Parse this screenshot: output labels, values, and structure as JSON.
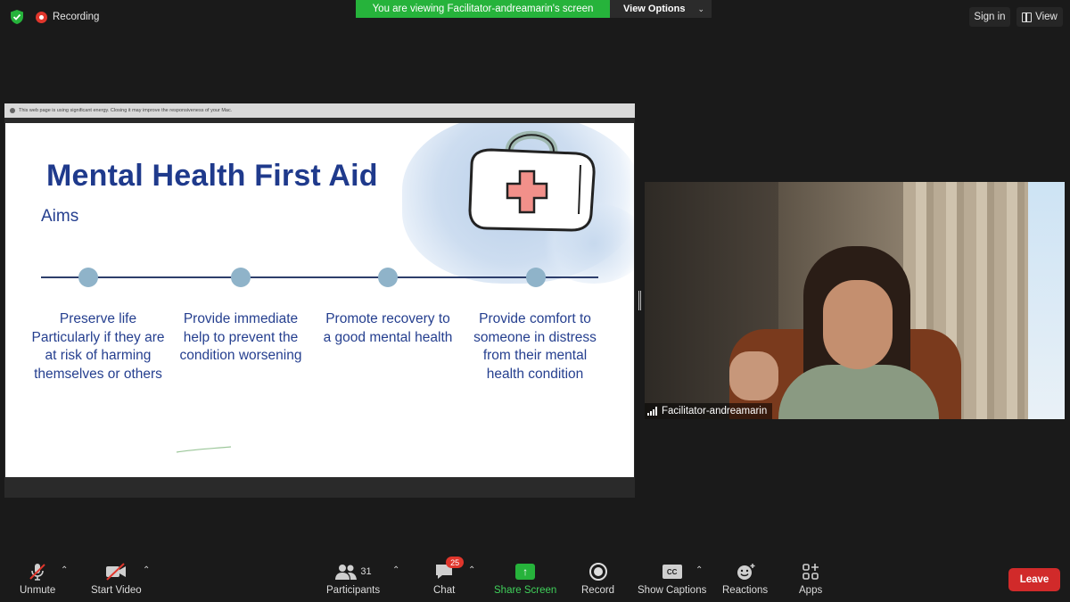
{
  "top_bar": {
    "recording_label": "Recording",
    "viewing_banner": "You are viewing Facilitator-andreamarin's screen",
    "view_options_label": "View Options",
    "sign_in_label": "Sign in",
    "view_label": "View"
  },
  "shared_screen": {
    "browser_notice": "This web page is using significant energy. Closing it may improve the responsiveness of your Mac.",
    "slide": {
      "title": "Mental Health First Aid",
      "subtitle": "Aims",
      "aims": [
        "Preserve life Particularly if they are at risk of harming themselves or others",
        "Provide immediate help to prevent the condition worsening",
        "Promote recovery to a good mental health",
        "Provide comfort to someone in distress from their mental health condition"
      ]
    }
  },
  "participant_video": {
    "name": "Facilitator-andreamarin"
  },
  "toolbar": {
    "unmute_label": "Unmute",
    "start_video_label": "Start Video",
    "participants_label": "Participants",
    "participants_count": "31",
    "chat_label": "Chat",
    "chat_badge": "25",
    "share_screen_label": "Share Screen",
    "record_label": "Record",
    "show_captions_label": "Show Captions",
    "cc_text": "CC",
    "reactions_label": "Reactions",
    "apps_label": "Apps",
    "leave_label": "Leave"
  },
  "colors": {
    "banner_green": "#26b33b",
    "slide_title_blue": "#1f3a8c",
    "timeline_dot": "#8fb3c9",
    "leave_red": "#d12a2a",
    "badge_red": "#e0362c"
  }
}
